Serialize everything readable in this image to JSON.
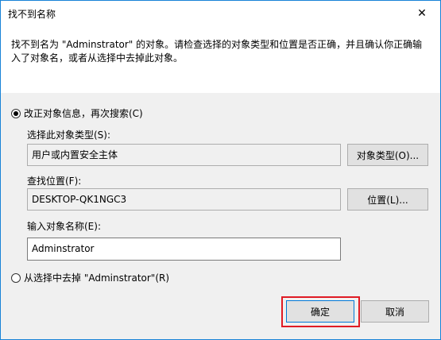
{
  "window": {
    "title": "找不到名称"
  },
  "message": "找不到名为 \"Adminstrator\" 的对象。请检查选择的对象类型和位置是否正确，并且确认你正确输入了对象名，或者从选择中去掉此对象。",
  "option_correct": {
    "label": "改正对象信息，再次搜索(C)",
    "object_type_label": "选择此对象类型(S):",
    "object_type_value": "用户或内置安全主体",
    "object_type_button": "对象类型(O)...",
    "location_label": "查找位置(F):",
    "location_value": "DESKTOP-QK1NGC3",
    "location_button": "位置(L)...",
    "name_label": "输入对象名称(E):",
    "name_value": "Adminstrator"
  },
  "option_remove": {
    "label": "从选择中去掉 \"Adminstrator\"(R)"
  },
  "buttons": {
    "ok": "确定",
    "cancel": "取消"
  }
}
